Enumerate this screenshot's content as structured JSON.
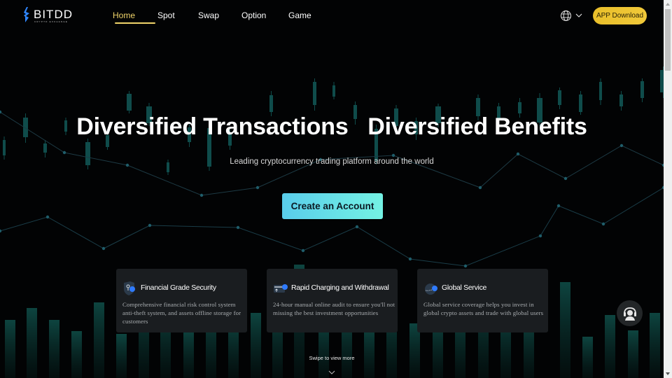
{
  "brand": {
    "name": "BITDD",
    "tagline": "CRYPTO EXCHANGE"
  },
  "nav": {
    "items": [
      {
        "label": "Home",
        "active": true
      },
      {
        "label": "Spot",
        "active": false
      },
      {
        "label": "Swap",
        "active": false
      },
      {
        "label": "Option",
        "active": false
      },
      {
        "label": "Game",
        "active": false
      }
    ],
    "language_icon": "globe-icon",
    "app_download_label": "APP Download"
  },
  "hero": {
    "title": "Diversified Transactions   Diversified Benefits",
    "subtitle": "Leading cryptocurrency trading platform around the world",
    "cta_label": "Create an Account"
  },
  "features": [
    {
      "icon": "shield-lock-icon",
      "title": "Financial Grade Security",
      "description": "Comprehensive financial risk control system anti-theft system, and assets offline storage for customers"
    },
    {
      "icon": "card-transfer-icon",
      "title": "Rapid Charging and Withdrawal",
      "description": "24-hour manual online audit to ensure you'll not missing the best investment opportunities"
    },
    {
      "icon": "globe-service-icon",
      "title": "Global Service",
      "description": "Global service coverage helps you invest in global crypto assets and trade with global users"
    }
  ],
  "swipe_hint": "Swipe to view more",
  "support_icon": "customer-service-icon",
  "colors": {
    "accent_gold": "#f0d46a",
    "button_gold": "#ecc233",
    "cta_gradient_start": "#59cdea",
    "cta_gradient_end": "#74f2e4",
    "card_bg": "#1a1d20",
    "teal_decor": "#0f4c4b"
  }
}
